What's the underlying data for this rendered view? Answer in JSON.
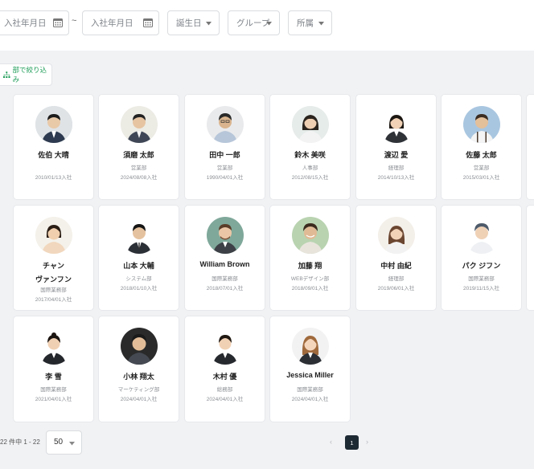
{
  "filters": {
    "hire_from_placeholder": "入社年月日",
    "range_separator": "~",
    "hire_to_placeholder": "入社年月日",
    "birthday_label": "誕生日",
    "group_label": "グループ",
    "affiliation_label": "所属",
    "filter_by_dept_label": "部で絞り込み"
  },
  "employees": [
    {
      "name": "佐伯 大晴",
      "dept": "",
      "date": "2010/01/13入社"
    },
    {
      "name": "須磨 太郎",
      "dept": "営業部",
      "date": "2024/08/08入社"
    },
    {
      "name": "田中 一郎",
      "dept": "営業部",
      "date": "1990/04/01入社"
    },
    {
      "name": "鈴木 美咲",
      "dept": "人事部",
      "date": "2012/08/15入社"
    },
    {
      "name": "渡辺 愛",
      "dept": "経理部",
      "date": "2014/10/13入社"
    },
    {
      "name": "佐藤 太郎",
      "dept": "営業部",
      "date": "2015/03/01入社"
    },
    {
      "name": "チャン",
      "name2": "ヴァンフン",
      "dept": "国際業務部",
      "date": "2017/04/01入社"
    },
    {
      "name": "山本 大輔",
      "dept": "システム部",
      "date": "2018/01/10入社"
    },
    {
      "name": "William Brown",
      "dept": "国際業務部",
      "date": "2018/07/01入社"
    },
    {
      "name": "加藤 翔",
      "dept": "WEBデザイン部",
      "date": "2018/09/01入社"
    },
    {
      "name": "中村 由紀",
      "dept": "経理部",
      "date": "2019/06/01入社"
    },
    {
      "name": "パク ジフン",
      "dept": "国際業務部",
      "date": "2019/11/15入社"
    },
    {
      "name": "李 雪",
      "dept": "国際業務部",
      "date": "2021/04/01入社"
    },
    {
      "name": "小林 翔太",
      "dept": "マーケティング部",
      "date": "2024/04/01入社"
    },
    {
      "name": "木村 優",
      "dept": "総務部",
      "date": "2024/04/01入社"
    },
    {
      "name": "Jessica Miller",
      "dept": "国際業務部",
      "date": "2024/04/01入社"
    }
  ],
  "pagination": {
    "info": "22 件中 1 - 22",
    "page_size": "50",
    "prev": "‹",
    "current_page": "1",
    "next": "›"
  },
  "colors": {
    "accent_green": "#1f9d59",
    "active_page": "#1e2a33",
    "background": "#f1f2f4"
  }
}
